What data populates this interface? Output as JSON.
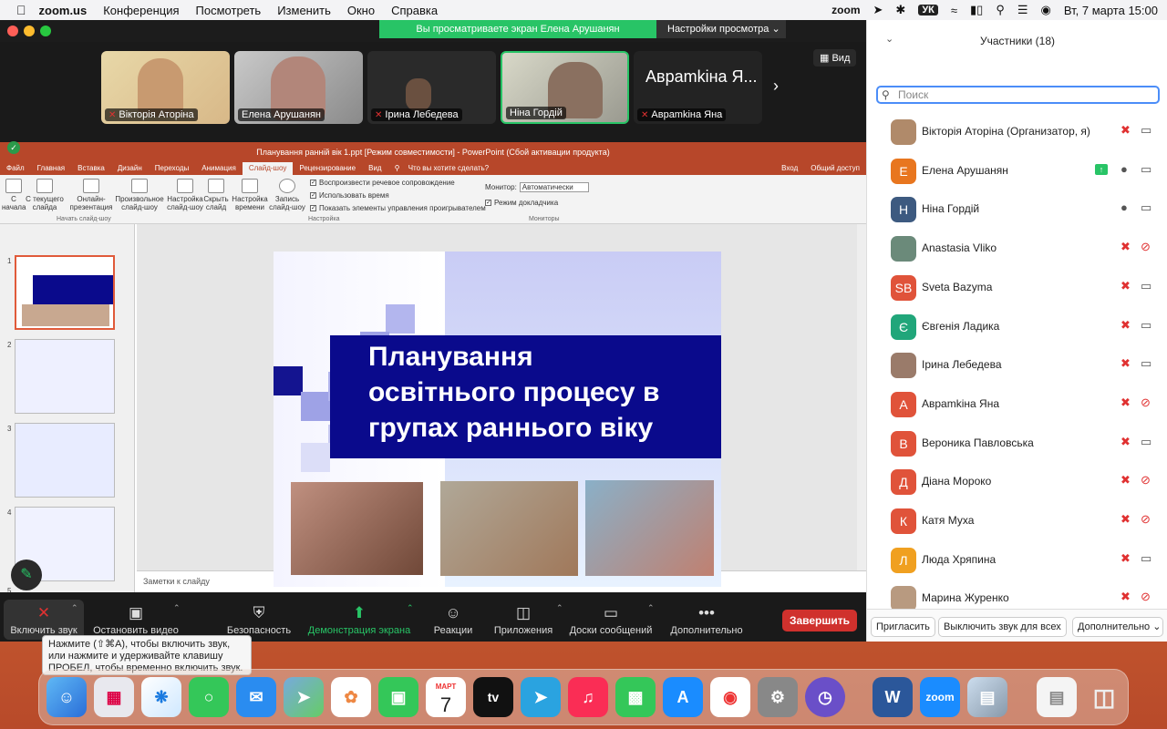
{
  "menubar": {
    "app": "zoom.us",
    "menus": [
      "Конференция",
      "Посмотреть",
      "Изменить",
      "Окно",
      "Справка"
    ],
    "status_zoom": "zoom",
    "lang": "УК",
    "datetime": "Вт, 7 марта  15:00"
  },
  "share_banner": {
    "text": "Вы просматриваете экран Елена Арушанян",
    "settings": "Настройки просмотра"
  },
  "view_button": "Вид",
  "video_tiles": [
    {
      "name": "Вікторія Аторіна",
      "muted": true
    },
    {
      "name": "Елена Арушанян",
      "muted": false
    },
    {
      "name": "Ірина Лебедева",
      "muted": true
    },
    {
      "name": "Ніна Гордій",
      "muted": false
    },
    {
      "name": "Авраmkіна Яна",
      "muted": true,
      "big_label": "Авраmkіна Я..."
    }
  ],
  "ppt": {
    "window_title": "Планування ранній вік 1.ppt [Режим совместимости] - PowerPoint (Сбой активации продукта)",
    "tabs": [
      "Файл",
      "Главная",
      "Вставка",
      "Дизайн",
      "Переходы",
      "Анимация",
      "Слайд-шоу",
      "Рецензирование",
      "Вид"
    ],
    "search_hint": "Что вы хотите сделать?",
    "login": "Вход",
    "share": "Общий доступ",
    "ribbon": {
      "from_start": "С начала",
      "from_current": "С текущего слайда",
      "online": "Онлайн-презентация",
      "custom": "Произвольное слайд-шоу",
      "setup": "Настройка слайд-шоу",
      "hide": "Скрыть слайд",
      "timing": "Настройка времени",
      "record": "Запись слайд-шоу",
      "opt1": "Воспроизвести речевое сопровождение",
      "opt2": "Использовать время",
      "opt3": "Показать элементы управления проигрывателем",
      "monitor_label": "Монитор:",
      "monitor_value": "Автоматически",
      "presenter": "Режим докладчика",
      "grp_start": "Начать слайд-шоу",
      "grp_setup": "Настройка",
      "grp_monitors": "Мониторы"
    },
    "slide_numbers": [
      "1",
      "2",
      "3",
      "4",
      "5"
    ],
    "slide_title": "Планування освітнього процесу в групах раннього віку",
    "slide_title_lines": [
      "Планування",
      "освітнього процесу в",
      "групах раннього віку"
    ],
    "notes": "Заметки к слайду"
  },
  "toolbar": {
    "unmute": "Включить звук",
    "stop_video": "Остановить видео",
    "security": "Безопасность",
    "share": "Демонстрация экрана",
    "reactions": "Реакции",
    "apps": "Приложения",
    "whiteboards": "Доски сообщений",
    "more": "Дополнительно",
    "end": "Завершить"
  },
  "tooltip": "Нажмите  (⇧⌘A), чтобы включить звук, или нажмите и удерживайте клавишу ПРОБЕЛ, чтобы временно включить звук.",
  "participants": {
    "title": "Участники (18)",
    "search_placeholder": "Поиск",
    "list": [
      {
        "name": "Вікторія Аторіна (Организатор, я)",
        "initials": "",
        "color": "#b08a6a",
        "mic": "muted",
        "cam": "on"
      },
      {
        "name": "Елена Арушанян",
        "initials": "Е",
        "color": "#e8761f",
        "mic": "on",
        "cam": "on",
        "sharing": true
      },
      {
        "name": "Ніна Гордій",
        "initials": "Н",
        "color": "#3d5a80",
        "mic": "on",
        "cam": "on"
      },
      {
        "name": "Anastasia Vliko",
        "initials": "",
        "color": "#6b8a7a",
        "mic": "muted",
        "cam": "off"
      },
      {
        "name": "Sveta Bazyma",
        "initials": "SB",
        "color": "#e0533a",
        "mic": "muted",
        "cam": "on"
      },
      {
        "name": "Євгенія Ладика",
        "initials": "Є",
        "color": "#21a67a",
        "mic": "muted",
        "cam": "on"
      },
      {
        "name": "Ірина Лебедева",
        "initials": "",
        "color": "#9a7b6a",
        "mic": "muted",
        "cam": "on"
      },
      {
        "name": "Авраmkіна Яна",
        "initials": "А",
        "color": "#e0533a",
        "mic": "muted",
        "cam": "off"
      },
      {
        "name": "Вероника Павловська",
        "initials": "В",
        "color": "#e0533a",
        "mic": "muted",
        "cam": "on"
      },
      {
        "name": "Діана Мороко",
        "initials": "Д",
        "color": "#e0533a",
        "mic": "muted",
        "cam": "off"
      },
      {
        "name": "Катя Муха",
        "initials": "К",
        "color": "#e0533a",
        "mic": "muted",
        "cam": "off"
      },
      {
        "name": "Люда Хряпина",
        "initials": "Л",
        "color": "#f0a020",
        "mic": "muted",
        "cam": "on"
      },
      {
        "name": "Марина Журенко",
        "initials": "",
        "color": "#b89a80",
        "mic": "muted",
        "cam": "off"
      }
    ],
    "invite": "Пригласить",
    "mute_all": "Выключить звук для всех",
    "more": "Дополнительно"
  },
  "dock": {
    "calendar_month": "МАРТ",
    "calendar_day": "7",
    "zoom_label": "zoom",
    "word_label": "W"
  },
  "colors": {
    "ppt_red": "#b7472a",
    "slide_navy": "#0a0a8c",
    "zoom_green": "#28c466",
    "end_red": "#d0312d"
  }
}
